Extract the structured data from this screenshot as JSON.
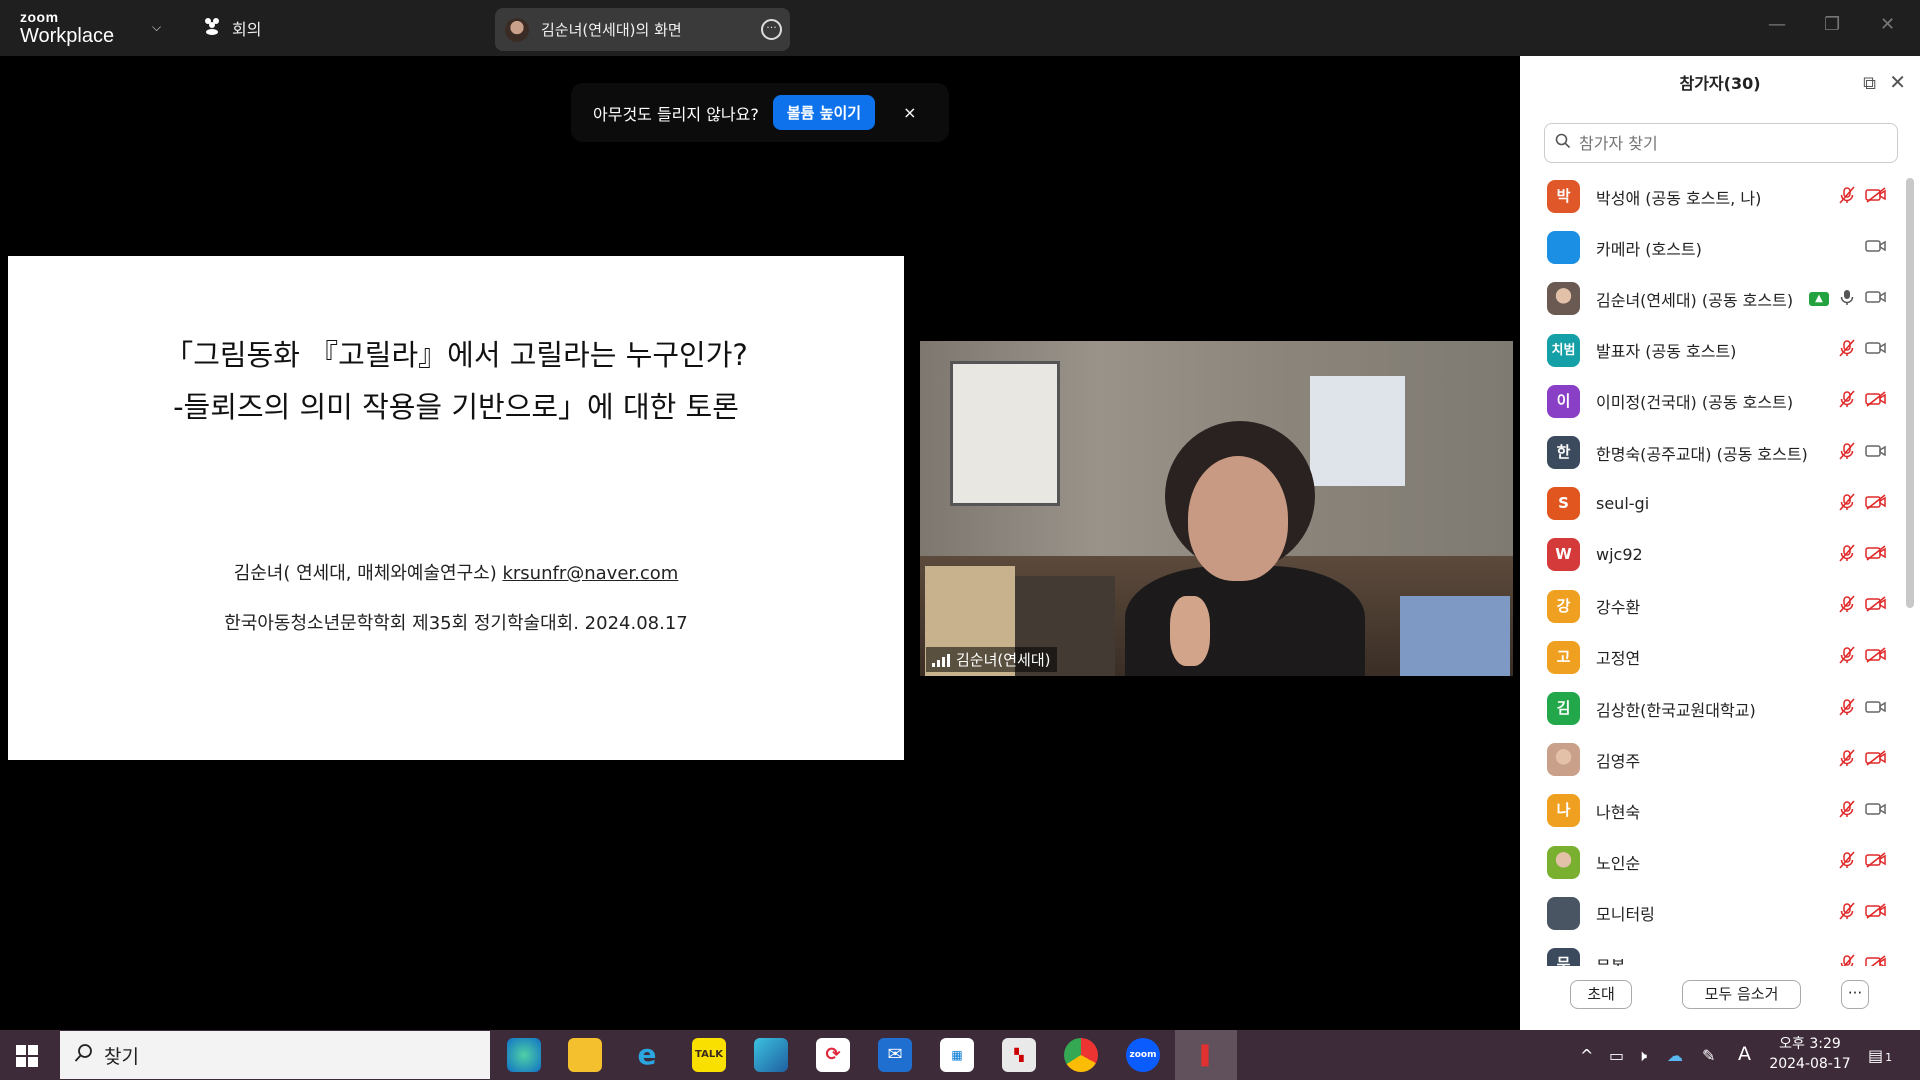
{
  "titlebar": {
    "logo_top": "zoom",
    "logo_bottom": "Workplace",
    "meeting_label": "회의",
    "share_label": "김순녀(연세대)의 화면"
  },
  "toast": {
    "message": "아무것도 들리지 않나요?",
    "button": "볼륨 높이기",
    "close": "×"
  },
  "slide": {
    "title_line1": "「그림동화 『고릴라』에서 고릴라는 누구인가?",
    "title_line2": "-들뢰즈의 의미 작용을 기반으로」에 대한 토론",
    "author_prefix": "김순녀( 연세대, 매체와예술연구소) ",
    "author_email": "krsunfr@naver.com",
    "conference": "한국아동청소년문학학회 제35회 정기학술대회. 2024.08.17"
  },
  "video": {
    "name": "김순녀(연세대)"
  },
  "panel": {
    "title": "참가자(30)",
    "search_placeholder": "참가자 찾기",
    "participants": [
      {
        "avatar": "박",
        "color": "#e0582a",
        "name": "박성애 (공동 호스트, 나)",
        "mic": "off",
        "cam": "off"
      },
      {
        "avatar": "",
        "color": "#1a8fe3",
        "name": "카메라 (호스트)",
        "mic": "",
        "cam": "on"
      },
      {
        "avatar": "photo",
        "color": "#6b5a52",
        "name": "김순녀(연세대) (공동 호스트)",
        "mic": "on",
        "cam": "on",
        "sharing": true
      },
      {
        "avatar": "치범",
        "color": "#15a0a8",
        "name": "발표자 (공동 호스트)",
        "mic": "off",
        "cam": "on"
      },
      {
        "avatar": "이",
        "color": "#8a3fc7",
        "name": "이미정(건국대) (공동 호스트)",
        "mic": "off",
        "cam": "off"
      },
      {
        "avatar": "한",
        "color": "#3b4a5c",
        "name": "한명숙(공주교대) (공동 호스트)",
        "mic": "off",
        "cam": "on"
      },
      {
        "avatar": "S",
        "color": "#e0561e",
        "name": "seul-gi",
        "mic": "off",
        "cam": "off"
      },
      {
        "avatar": "W",
        "color": "#d53a3a",
        "name": "wjc92",
        "mic": "off",
        "cam": "off"
      },
      {
        "avatar": "강",
        "color": "#f0a020",
        "name": "강수환",
        "mic": "off",
        "cam": "off"
      },
      {
        "avatar": "고",
        "color": "#f0a020",
        "name": "고정연",
        "mic": "off",
        "cam": "off"
      },
      {
        "avatar": "김",
        "color": "#22a84a",
        "name": "김상한(한국교원대학교)",
        "mic": "off",
        "cam": "on"
      },
      {
        "avatar": "photo2",
        "color": "#c9a089",
        "name": "김영주",
        "mic": "off",
        "cam": "off"
      },
      {
        "avatar": "나",
        "color": "#f0a020",
        "name": "나현숙",
        "mic": "off",
        "cam": "on"
      },
      {
        "avatar": "photo3",
        "color": "#7ab030",
        "name": "노인순",
        "mic": "off",
        "cam": "off"
      },
      {
        "avatar": "",
        "color": "#4a5563",
        "name": "모니터링",
        "mic": "off",
        "cam": "off"
      },
      {
        "avatar": "문",
        "color": "#3b4a5c",
        "name": "문봉",
        "mic": "off",
        "cam": "off"
      }
    ],
    "invite": "초대",
    "mute_all": "모두 음소거",
    "more": "···"
  },
  "taskbar": {
    "search": "찾기",
    "time_ampm": "오후 3:29",
    "date": "2024-08-17",
    "ime": "A",
    "notification_count": "1"
  },
  "icons": {
    "muted": "mic-off-icon",
    "camera_off": "camera-off-icon"
  }
}
